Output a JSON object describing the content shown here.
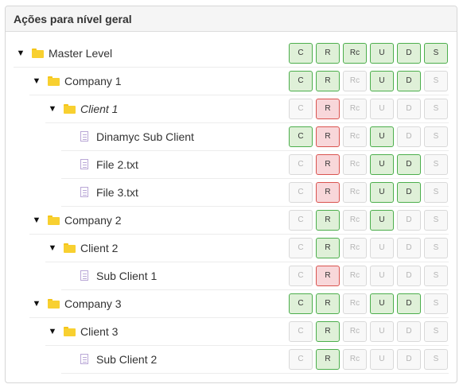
{
  "panel": {
    "title": "Ações para nível geral"
  },
  "permission_columns": [
    "C",
    "R",
    "Rc",
    "U",
    "D",
    "S"
  ],
  "colors": {
    "granted": "#dff0d8",
    "granted_border": "#4cae4c",
    "denied": "#f8d7da",
    "denied_border": "#d9534f",
    "neutral": "#f8f8f8"
  },
  "tree": [
    {
      "label": "Master Level",
      "icon": "folder-icon",
      "expanded": true,
      "italic": false,
      "depth": 0,
      "perms": [
        "on",
        "on",
        "on",
        "on",
        "on",
        "on"
      ]
    },
    {
      "label": "Company 1",
      "icon": "folder-icon",
      "expanded": true,
      "italic": false,
      "depth": 1,
      "perms": [
        "on",
        "on",
        "off",
        "on",
        "on",
        "off"
      ]
    },
    {
      "label": "Client 1",
      "icon": "folder-icon",
      "expanded": true,
      "italic": true,
      "depth": 2,
      "perms": [
        "off",
        "deny",
        "off",
        "off",
        "off",
        "off"
      ]
    },
    {
      "label": "Dinamyc Sub Client",
      "icon": "file-icon",
      "expanded": null,
      "italic": false,
      "depth": 3,
      "perms": [
        "on",
        "deny",
        "off",
        "on",
        "off",
        "off"
      ]
    },
    {
      "label": "File 2.txt",
      "icon": "file-icon",
      "expanded": null,
      "italic": false,
      "depth": 3,
      "perms": [
        "off",
        "deny",
        "off",
        "on",
        "on",
        "off"
      ]
    },
    {
      "label": "File 3.txt",
      "icon": "file-icon",
      "expanded": null,
      "italic": false,
      "depth": 3,
      "perms": [
        "off",
        "deny",
        "off",
        "on",
        "on",
        "off"
      ]
    },
    {
      "label": "Company 2",
      "icon": "folder-icon",
      "expanded": true,
      "italic": false,
      "depth": 1,
      "perms": [
        "off",
        "on",
        "off",
        "on",
        "off",
        "off"
      ]
    },
    {
      "label": "Client 2",
      "icon": "folder-icon",
      "expanded": true,
      "italic": false,
      "depth": 2,
      "perms": [
        "off",
        "on",
        "off",
        "off",
        "off",
        "off"
      ]
    },
    {
      "label": "Sub Client 1",
      "icon": "file-icon",
      "expanded": null,
      "italic": false,
      "depth": 3,
      "perms": [
        "off",
        "deny",
        "off",
        "off",
        "off",
        "off"
      ]
    },
    {
      "label": "Company 3",
      "icon": "folder-icon",
      "expanded": true,
      "italic": false,
      "depth": 1,
      "perms": [
        "on",
        "on",
        "off",
        "on",
        "on",
        "off"
      ]
    },
    {
      "label": "Client 3",
      "icon": "folder-icon",
      "expanded": true,
      "italic": false,
      "depth": 2,
      "perms": [
        "off",
        "on",
        "off",
        "off",
        "off",
        "off"
      ]
    },
    {
      "label": "Sub Client 2",
      "icon": "file-icon",
      "expanded": null,
      "italic": false,
      "depth": 3,
      "perms": [
        "off",
        "on",
        "off",
        "off",
        "off",
        "off"
      ]
    }
  ]
}
